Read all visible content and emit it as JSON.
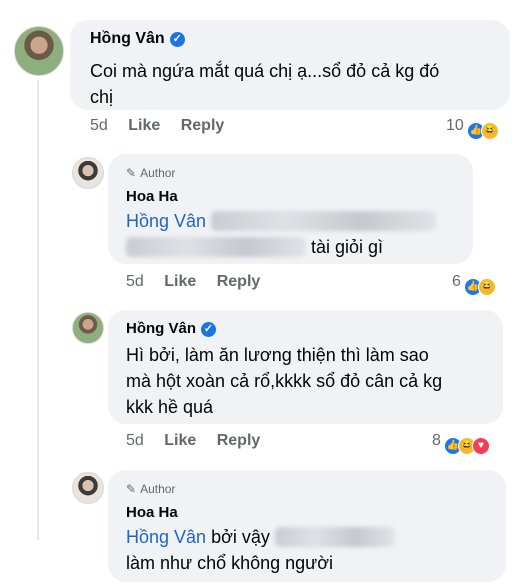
{
  "comments": [
    {
      "name": "Hồng Vân",
      "verified": true,
      "text_line1": "Coi mà ngứa mắt quá chị ạ...sổ đỏ cả kg đó",
      "text_line2": "chị",
      "time": "5d",
      "like_label": "Like",
      "reply_label": "Reply",
      "reaction_count": "10"
    },
    {
      "author_badge": "Author",
      "name": "Hoa Ha",
      "mention": "Hồng Vân",
      "text_line2": "tài giỏi gì",
      "time": "5d",
      "like_label": "Like",
      "reply_label": "Reply",
      "reaction_count": "6"
    },
    {
      "name": "Hồng Vân",
      "verified": true,
      "text_line1": "Hì bởi, làm ăn lương thiện thì làm sao",
      "text_line2": "mà hột xoàn cả rổ,kkkk sổ đỏ cân cả kg",
      "text_line3": "kkk hề quá",
      "time": "5d",
      "like_label": "Like",
      "reply_label": "Reply",
      "reaction_count": "8"
    },
    {
      "author_badge": "Author",
      "name": "Hoa Ha",
      "mention": "Hồng Vân",
      "text_line1_rest": "bởi vậy",
      "text_line2": "làm như chổ không người"
    }
  ],
  "icons": {
    "verified": "verified-check-icon",
    "author": "pencil-icon",
    "like_reaction": "like-reaction-icon",
    "haha_reaction": "haha-reaction-icon",
    "love_reaction": "love-reaction-icon"
  },
  "colors": {
    "bubble": "#f0f2f5",
    "mention": "#1d65c8",
    "meta": "#65676b",
    "verified": "#1b74e4"
  }
}
